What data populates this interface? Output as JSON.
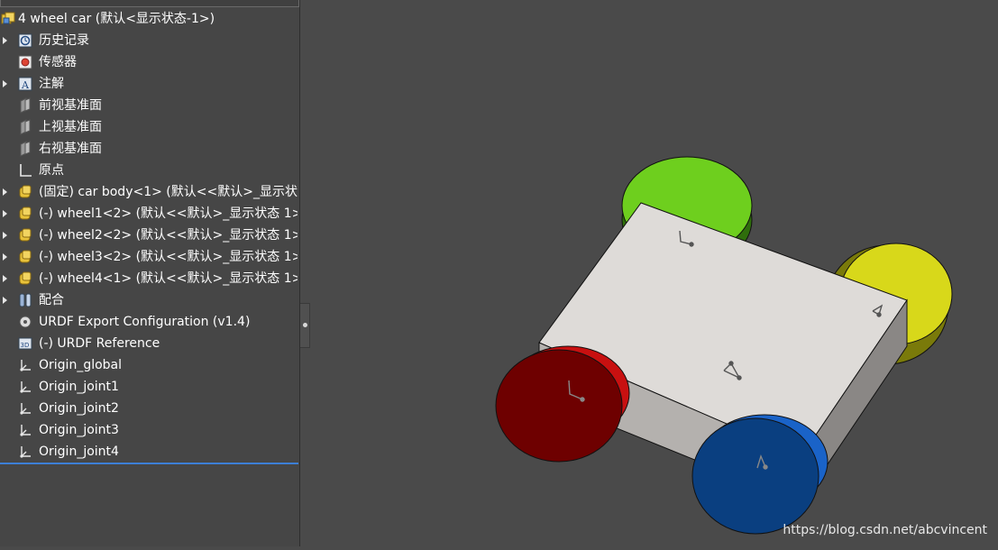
{
  "tree": {
    "root_label": "4 wheel car  (默认<显示状态-1>)",
    "items": [
      {
        "label": "历史记录",
        "has_arrow": true
      },
      {
        "label": "传感器",
        "has_arrow": false
      },
      {
        "label": "注解",
        "has_arrow": true
      },
      {
        "label": "前视基准面",
        "has_arrow": false
      },
      {
        "label": "上视基准面",
        "has_arrow": false
      },
      {
        "label": "右视基准面",
        "has_arrow": false
      },
      {
        "label": "原点",
        "has_arrow": false
      },
      {
        "label": "(固定) car body<1> (默认<<默认>_显示状",
        "has_arrow": true
      },
      {
        "label": "(-) wheel1<2> (默认<<默认>_显示状态 1>",
        "has_arrow": true
      },
      {
        "label": "(-) wheel2<2> (默认<<默认>_显示状态 1>",
        "has_arrow": true
      },
      {
        "label": "(-) wheel3<2> (默认<<默认>_显示状态 1>",
        "has_arrow": true
      },
      {
        "label": "(-) wheel4<1> (默认<<默认>_显示状态 1>",
        "has_arrow": true
      },
      {
        "label": "配合",
        "has_arrow": true
      },
      {
        "label": "URDF Export Configuration (v1.4)",
        "has_arrow": false
      },
      {
        "label": "(-) URDF Reference",
        "has_arrow": false
      },
      {
        "label": "Origin_global",
        "has_arrow": false
      },
      {
        "label": "Origin_joint1",
        "has_arrow": false
      },
      {
        "label": "Origin_joint2",
        "has_arrow": false
      },
      {
        "label": "Origin_joint3",
        "has_arrow": false
      },
      {
        "label": "Origin_joint4",
        "has_arrow": false
      }
    ],
    "icons": [
      "assembly-icon",
      "history-icon",
      "sensor-icon",
      "annotation-icon",
      "plane-icon",
      "plane-icon",
      "plane-icon",
      "origin-icon",
      "part-icon",
      "part-icon",
      "part-icon",
      "part-icon",
      "part-icon",
      "mates-icon",
      "urdf-config-icon",
      "urdf-reference-icon",
      "coordinate-system-icon",
      "coordinate-system-icon",
      "coordinate-system-icon",
      "coordinate-system-icon",
      "coordinate-system-icon"
    ]
  },
  "viewport": {
    "wheel_colors": {
      "front_left": "#c81010",
      "front_right": "#1a63c8",
      "rear_left": "#6ecf1e",
      "rear_right": "#d8d81a"
    },
    "body_color": "#dedbd8",
    "background": "#4a4a4a"
  },
  "watermark": "https://blog.csdn.net/abcvincent"
}
